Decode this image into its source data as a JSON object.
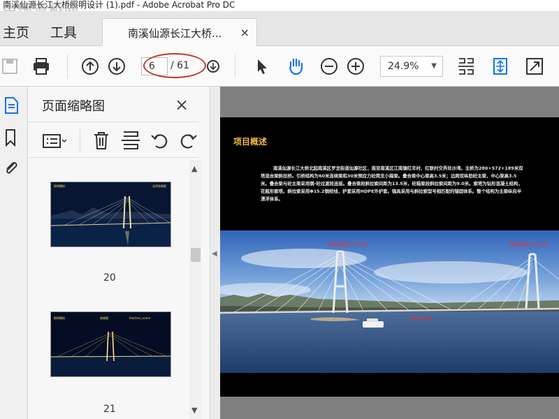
{
  "window": {
    "title": "南溪仙源长江大桥照明设计 (1).pdf - Adobe Acrobat Pro DC",
    "watermark": "中国道桥网"
  },
  "nav": {
    "home_label": "主页",
    "tools_label": "工具"
  },
  "document_tab": {
    "label": "南溪仙源长江大桥...",
    "close": "×"
  },
  "toolbar": {
    "current_page": "6",
    "total_pages": "/ 61",
    "zoom": "24.9%",
    "zoom_caret": "▼"
  },
  "thumbnail_panel": {
    "title": "页面缩略图",
    "close": "×",
    "thumbnails": [
      {
        "number": "20",
        "caption_left": "照明模拟",
        "caption_right": "全桥效果图"
      },
      {
        "number": "21",
        "caption_left": "照明模拟",
        "caption_mid": "效果图",
        "caption_right": "Electron_scene"
      }
    ],
    "scroll_up": "▲",
    "scroll_down": "▼",
    "collapse_arrow": "◀"
  },
  "page": {
    "heading": "项目概述",
    "body": "南溪仙源长江大桥北起南溪区罗龙街道仙源社区，南至南溪区江南镇红丰村、红联村交界处沙湾。主桥为280+572+189米双塔混合梁斜拉桥。引桥结构为60米连续梁和30米预应力砼简支小箱梁。叠合梁中心梁高3.5米；边跨双纵肋砼主梁，中心梁高3.5米。叠合梁与砼主梁采用钢-砼过渡段连接。叠合梁段斜拉索间距为13.5米，砼箱梁段斜拉索间距为9.0米。索塔为钻形混凝土结构，花瓶形索塔。斜拉索采用Φ15.2钢绞线，护套采用HDPE外护套。锚具采用与斜拉索型号相匹配的锚固体系。整个结构为主梁纵向半漂浮体系。",
    "label_north_tower": "北塔高度170.00米",
    "label_south_tower": "南塔高度160.22米",
    "label_main_span": "主跨572米"
  },
  "colors": {
    "accent_blue": "#1473e6",
    "annotation_red": "#c0392b",
    "page_heading": "#f5b942"
  }
}
